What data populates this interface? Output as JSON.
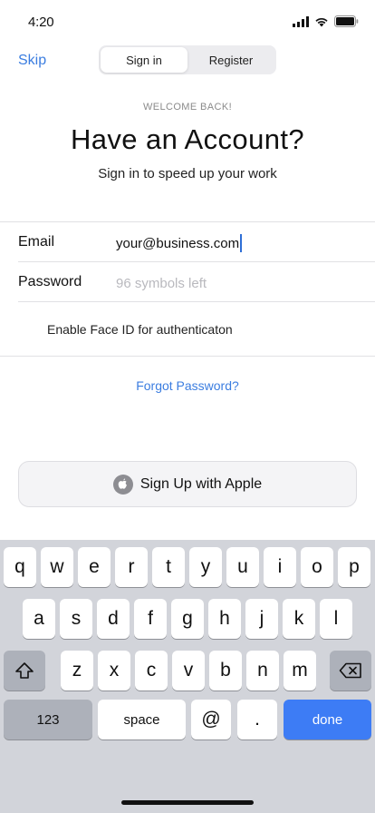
{
  "status_bar": {
    "time": "4:20"
  },
  "header": {
    "skip_label": "Skip",
    "tabs": [
      {
        "label": "Sign in",
        "active": true
      },
      {
        "label": "Register",
        "active": false
      }
    ]
  },
  "hero": {
    "eyebrow": "WELCOME BACK!",
    "title": "Have an Account?",
    "subtitle": "Sign in to speed up your work"
  },
  "form": {
    "email_label": "Email",
    "email_value": "your@business.com",
    "password_label": "Password",
    "password_placeholder": "96 symbols left",
    "face_id_label": "Enable Face ID for authenticaton"
  },
  "forgot_password": "Forgot Password?",
  "apple_button": {
    "label": "Sign Up with Apple"
  },
  "keyboard": {
    "row1": [
      "q",
      "w",
      "e",
      "r",
      "t",
      "y",
      "u",
      "i",
      "o",
      "p"
    ],
    "row2": [
      "a",
      "s",
      "d",
      "f",
      "g",
      "h",
      "j",
      "k",
      "l"
    ],
    "row3": [
      "z",
      "x",
      "c",
      "v",
      "b",
      "n",
      "m"
    ],
    "numbers_label": "123",
    "space_label": "space",
    "at_label": "@",
    "dot_label": ".",
    "done_label": "done"
  },
  "colors": {
    "accent": "#3b7de0",
    "done_key": "#3d7cf5",
    "keyboard_bg": "#d2d4da"
  }
}
